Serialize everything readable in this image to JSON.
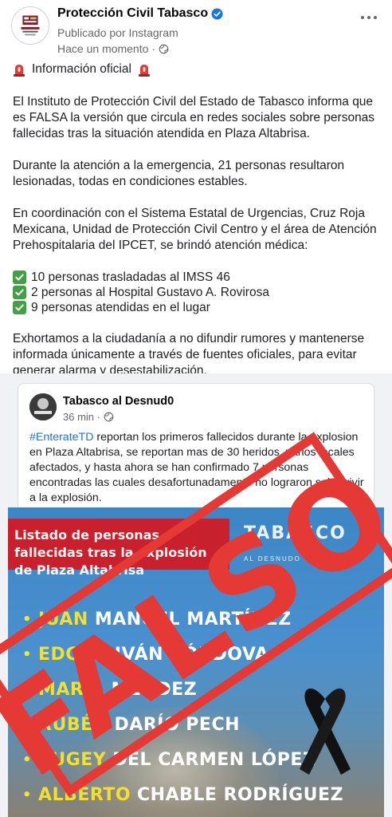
{
  "header": {
    "page_name": "Protección Civil Tabasco",
    "published_via": "Publicado por Instagram",
    "time": "Hace un momento",
    "avatar_text": "PROTECCIÓN CIVIL"
  },
  "post": {
    "title": "Información oficial",
    "paragraphs": [
      "El Instituto de Protección Civil del Estado de Tabasco informa que es FALSA la versión que circula en redes sociales sobre personas fallecidas tras la situación atendida en Plaza Altabrisa.",
      "Durante la atención a la emergencia, 21 personas resultaron lesionadas, todas en condiciones estables.",
      "En coordinación con el Sistema Estatal de Urgencias, Cruz Roja Mexicana, Unidad de Protección Civil Centro y el área de Atención Prehospitalaria del IPCET, se brindó atención médica:"
    ],
    "checklist": [
      "10 personas trasladadas al IMSS 46",
      "2 personas al Hospital Gustavo A. Rovirosa",
      "9 personas atendidas en el lugar"
    ],
    "closing": "Exhortamos a la ciudadanía a no difundir rumores y mantenerse informada únicamente a través de fuentes oficiales, para evitar generar alarma y desestabilización."
  },
  "shared": {
    "author": "Tabasco al Desnud0",
    "time": "36 min ·",
    "hashtag": "#EnterateTD",
    "text": " reportan los primeros fallecidos durante la explosion en Plaza Altabrisa, se reportan mas de 30 heridos, varios locales afectados, y hasta ahora se han confirmado 7 personas encontradas las cuales desafortunadamente no lograron sobrevivir a la explosión.",
    "image": {
      "banner": "Listado de personas fallecidas tras la explosión de Plaza Altabrisa",
      "brand": "TABASCO",
      "brand_sub": "AL DESNUDO",
      "names": [
        {
          "first": "JUAN",
          "rest": "MANUEL MARTÍNEZ"
        },
        {
          "first": "EDGAR",
          "rest": "IVÁN CÓRDOVA"
        },
        {
          "first": "MARÍA",
          "rest": "MÉNDEZ"
        },
        {
          "first": "RUBÉN",
          "rest": "DARÍO PECH"
        },
        {
          "first": "SUGEY",
          "rest": "DEL CARMEN LÓPEZ"
        },
        {
          "first": "ALBERTO",
          "rest": "CHABLE RODRÍGUEZ"
        }
      ]
    }
  },
  "stamp": {
    "text": "FALSO",
    "color": "#e53935"
  }
}
